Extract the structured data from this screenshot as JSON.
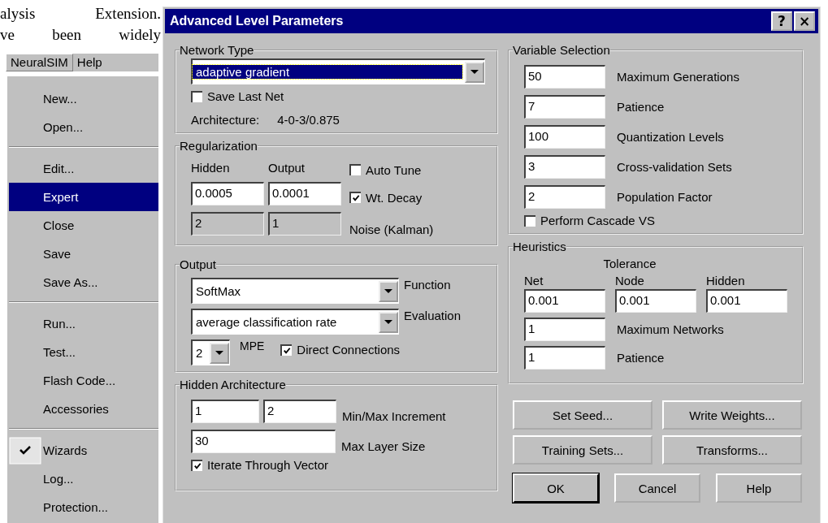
{
  "document_text": [
    "alysis Extension.",
    "ve been widely"
  ],
  "menu_bar": [
    {
      "label": "NeuralSIM",
      "selected": true
    },
    {
      "label": "Help",
      "selected": false
    }
  ],
  "menu": [
    [
      {
        "label": "New...",
        "selected": false,
        "checked": false
      },
      {
        "label": "Open...",
        "selected": false,
        "checked": false
      }
    ],
    [
      {
        "label": "Edit...",
        "selected": false,
        "checked": false
      },
      {
        "label": "Expert",
        "selected": true,
        "checked": false
      },
      {
        "label": "Close",
        "selected": false,
        "checked": false
      },
      {
        "label": "Save",
        "selected": false,
        "checked": false
      },
      {
        "label": "Save As...",
        "selected": false,
        "checked": false
      }
    ],
    [
      {
        "label": "Run...",
        "selected": false,
        "checked": false
      },
      {
        "label": "Test...",
        "selected": false,
        "checked": false
      },
      {
        "label": "Flash Code...",
        "selected": false,
        "checked": false
      },
      {
        "label": "Accessories",
        "selected": false,
        "checked": false
      }
    ],
    [
      {
        "label": "Wizards",
        "selected": false,
        "checked": true
      },
      {
        "label": "Log...",
        "selected": false,
        "checked": false
      },
      {
        "label": "Protection...",
        "selected": false,
        "checked": false
      }
    ]
  ],
  "dialog": {
    "title": "Advanced Level Parameters",
    "help_button": "?",
    "close_button": "×"
  },
  "network_type": {
    "title": "Network Type",
    "dropdown": "adaptive gradient",
    "save_last_net": {
      "label": "Save Last Net",
      "checked": false
    },
    "architecture_label": "Architecture:",
    "architecture_value": "4-0-3/0.875"
  },
  "regularization": {
    "title": "Regularization",
    "hidden_label": "Hidden",
    "output_label": "Output",
    "fields": [
      {
        "value": "0.0005",
        "disabled": false
      },
      {
        "value": "0.0001",
        "disabled": false
      },
      {
        "value": "2",
        "disabled": true
      },
      {
        "value": "1",
        "disabled": true
      }
    ],
    "checkboxes": [
      {
        "label": "Auto Tune",
        "checked": false
      },
      {
        "label": "Wt. Decay",
        "checked": true
      }
    ],
    "noise_label": "Noise (Kalman)"
  },
  "output": {
    "title": "Output",
    "function": {
      "value": "SoftMax",
      "label": "Function"
    },
    "evaluation": {
      "value": "average classification rate",
      "label": "Evaluation"
    },
    "mpe": {
      "value": "2",
      "label": "MPE"
    },
    "direct_connections": {
      "label": "Direct Connections",
      "checked": true
    }
  },
  "hidden_architecture": {
    "title": "Hidden Architecture",
    "min": "1",
    "max": "2",
    "increment_label": "Min/Max Increment",
    "max_layer_size": "30",
    "max_layer_size_label": "Max Layer Size",
    "iterate": {
      "label": "Iterate Through Vector",
      "checked": true
    }
  },
  "variable_selection": {
    "title": "Variable Selection",
    "rows": [
      {
        "value": "50",
        "label": "Maximum Generations"
      },
      {
        "value": "7",
        "label": "Patience"
      },
      {
        "value": "100",
        "label": "Quantization Levels"
      },
      {
        "value": "3",
        "label": "Cross-validation Sets"
      },
      {
        "value": "2",
        "label": "Population Factor"
      }
    ],
    "cascade": {
      "label": "Perform Cascade VS",
      "checked": false
    }
  },
  "heuristics": {
    "title": "Heuristics",
    "tolerance_label": "Tolerance",
    "columns": [
      {
        "label": "Net",
        "value": "0.001"
      },
      {
        "label": "Node",
        "value": "0.001"
      },
      {
        "label": "Hidden",
        "value": "0.001"
      }
    ],
    "rows": [
      {
        "value": "1",
        "label": "Maximum Networks"
      },
      {
        "value": "1",
        "label": "Patience"
      }
    ]
  },
  "buttons": [
    [
      "Set Seed...",
      "Write Weights..."
    ],
    [
      "Training Sets...",
      "Transforms..."
    ]
  ],
  "dialog_buttons": [
    {
      "label": "OK",
      "default": true
    },
    {
      "label": "Cancel",
      "default": false
    },
    {
      "label": "Help",
      "default": false
    }
  ]
}
